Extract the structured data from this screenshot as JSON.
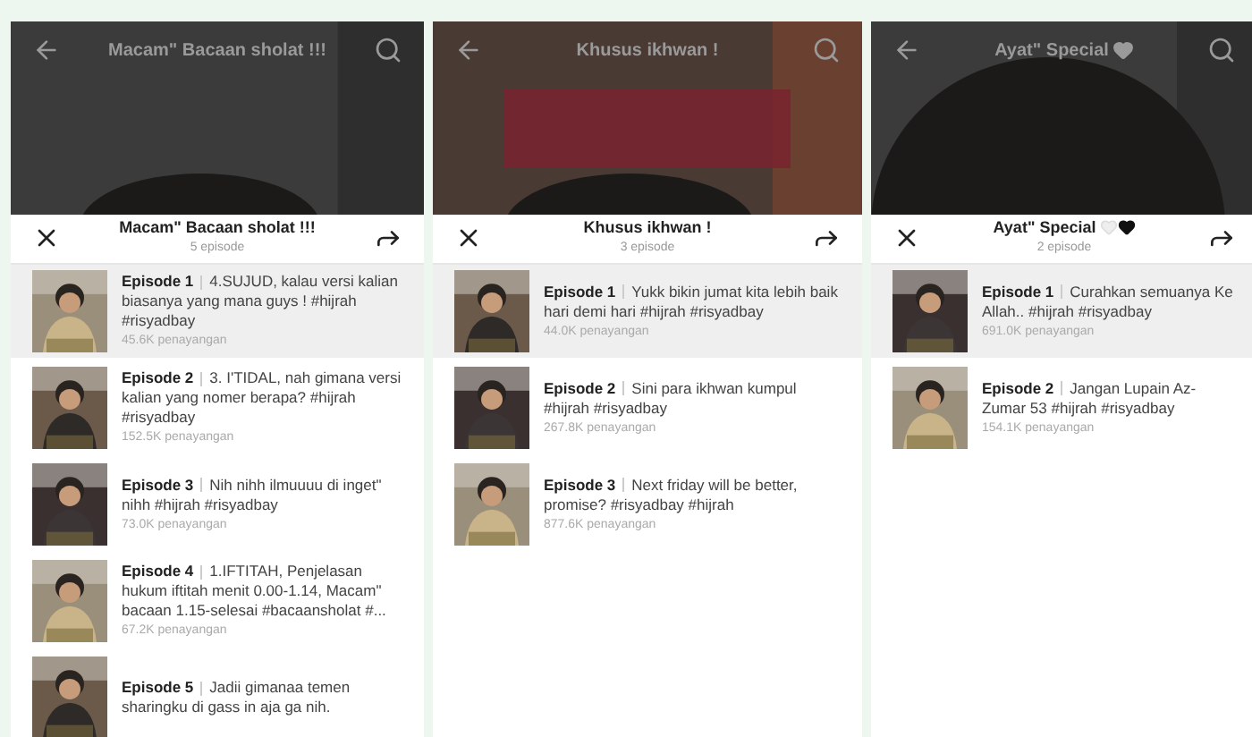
{
  "panels": [
    {
      "top_title": "Macam\" Bacaan sholat !!!",
      "sheet_title": "Macam\" Bacaan sholat !!!",
      "episode_count": "5 episode",
      "hearts": false,
      "episodes": [
        {
          "label": "Episode 1",
          "description": "4.SUJUD, kalau versi kalian biasanya yang mana guys ! #hijrah #risyadbay",
          "views": "45.6K penayangan",
          "selected": true
        },
        {
          "label": "Episode 2",
          "description": "3. I'TIDAL, nah gimana versi kalian yang nomer berapa? #hijrah #risyadbay",
          "views": "152.5K penayangan",
          "selected": false
        },
        {
          "label": "Episode 3",
          "description": "Nih nihh ilmuuuu di inget\" nihh #hijrah #risyadbay",
          "views": "73.0K penayangan",
          "selected": false
        },
        {
          "label": "Episode 4",
          "description": "1.IFTITAH, Penjelasan hukum iftitah menit 0.00-1.14, Macam\" bacaan 1.15-selesai #bacaansholat #...",
          "views": "67.2K penayangan",
          "selected": false
        },
        {
          "label": "Episode 5",
          "description": "Jadii gimanaa temen sharingku di gass in aja ga nih.",
          "selected": false
        }
      ]
    },
    {
      "top_title": "Khusus ikhwan !",
      "sheet_title": "Khusus ikhwan !",
      "episode_count": "3 episode",
      "hearts": false,
      "episodes": [
        {
          "label": "Episode 1",
          "description": "Yukk bikin jumat kita lebih baik hari demi hari #hijrah #risyadbay",
          "views": "44.0K penayangan",
          "selected": true
        },
        {
          "label": "Episode 2",
          "description": "Sini para ikhwan kumpul #hijrah #risyadbay",
          "views": "267.8K penayangan",
          "selected": false
        },
        {
          "label": "Episode 3",
          "description": "Next friday will be better, promise? #risyadbay #hijrah",
          "views": "877.6K penayangan",
          "selected": false
        }
      ]
    },
    {
      "top_title": "Ayat\" Special",
      "sheet_title": "Ayat\" Special",
      "episode_count": "2 episode",
      "hearts": true,
      "episodes": [
        {
          "label": "Episode 1",
          "description": "Curahkan semuanya Ke Allah.. #hijrah #risyadbay",
          "views": "691.0K penayangan",
          "selected": true
        },
        {
          "label": "Episode 2",
          "description": "Jangan Lupain Az-Zumar 53 #hijrah #risyadbay",
          "views": "154.1K penayangan",
          "selected": false
        }
      ]
    }
  ]
}
